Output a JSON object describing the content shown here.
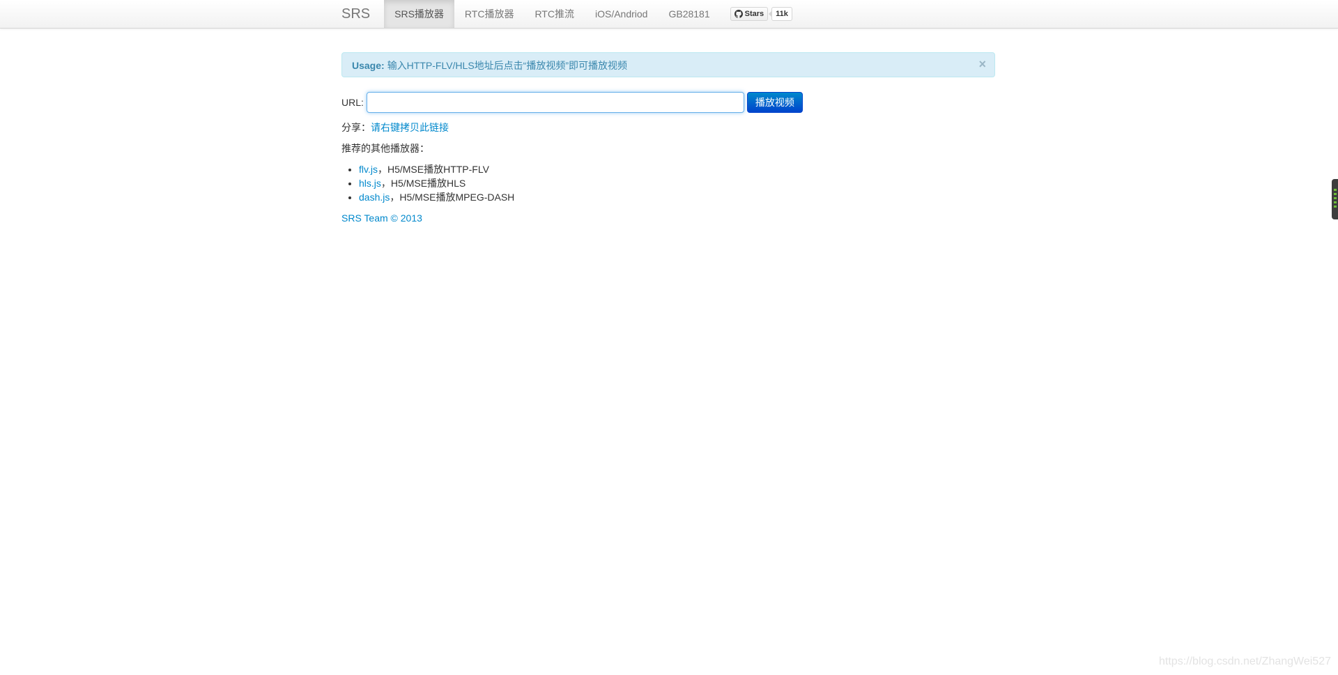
{
  "navbar": {
    "brand": "SRS",
    "items": [
      {
        "label": "SRS播放器",
        "active": true
      },
      {
        "label": "RTC播放器",
        "active": false
      },
      {
        "label": "RTC推流",
        "active": false
      },
      {
        "label": "iOS/Andriod",
        "active": false
      },
      {
        "label": "GB28181",
        "active": false
      }
    ],
    "github": {
      "stars_label": "Stars",
      "count": "11k",
      "icon": "github-icon"
    }
  },
  "alert": {
    "title": "Usage:",
    "message": "输入HTTP-FLV/HLS地址后点击“播放视频”即可播放视频",
    "close": "×"
  },
  "url_row": {
    "label": "URL:",
    "value": "",
    "button": "播放视频"
  },
  "share": {
    "label": "分享：",
    "link": "请右键拷贝此链接"
  },
  "recommend": {
    "title": "推荐的其他播放器：",
    "items": [
      {
        "link": "flv.js",
        "desc": "，H5/MSE播放HTTP-FLV"
      },
      {
        "link": "hls.js",
        "desc": "，H5/MSE播放HLS"
      },
      {
        "link": "dash.js",
        "desc": "，H5/MSE播放MPEG-DASH"
      }
    ]
  },
  "footer": {
    "text": "SRS Team © 2013"
  },
  "watermark": "https://blog.csdn.net/ZhangWei527",
  "colors": {
    "link": "#0088cc",
    "alert_bg": "#d9edf7",
    "button_bg": "#0044cc"
  }
}
